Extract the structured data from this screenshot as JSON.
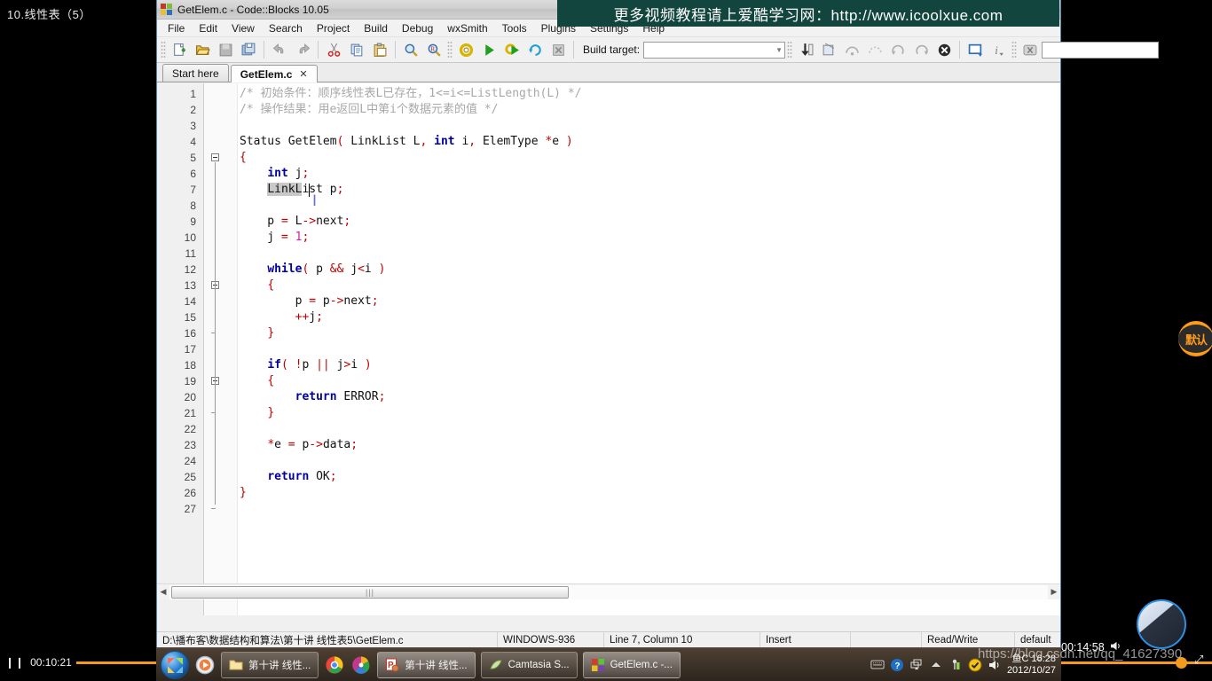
{
  "player": {
    "video_title": "10.线性表（5）",
    "elapsed_left": "00:10:21",
    "pause_glyph": "❙❙",
    "time_right": "00:14:58",
    "volume_icon": "volume-icon",
    "fullscreen_icon": "fullscreen-icon",
    "watermark": "https://blog.csdn.net/qq_41627390"
  },
  "promo_banner": {
    "text": "更多视频教程请上爱酷学习网：http://www.icoolxue.com"
  },
  "badge": {
    "label": "默认"
  },
  "window": {
    "title": "GetElem.c - Code::Blocks 10.05",
    "logo_icon": "codeblocks-logo-icon"
  },
  "menubar": {
    "items": [
      "File",
      "Edit",
      "View",
      "Search",
      "Project",
      "Build",
      "Debug",
      "wxSmith",
      "Tools",
      "Plugins",
      "Settings",
      "Help"
    ]
  },
  "toolbar": {
    "main_icons": [
      "new-file-icon",
      "open-file-icon",
      "save-icon",
      "save-all-icon",
      "undo-icon",
      "redo-icon",
      "cut-icon",
      "copy-icon",
      "paste-icon",
      "find-icon",
      "replace-icon"
    ],
    "compiler_icons": [
      "build-icon",
      "run-icon",
      "build-and-run-icon",
      "rebuild-icon",
      "abort-icon"
    ],
    "build_target_label": "Build target:",
    "build_target_value": "",
    "debug_icons": [
      "debug-continue-icon",
      "debug-run-to-cursor-icon",
      "debug-next-line-icon",
      "debug-step-into-icon",
      "debug-step-out-icon",
      "debug-next-instruction-icon",
      "debug-stop-icon",
      "debug-windows-icon",
      "debug-info-icon"
    ],
    "doc_icons": [
      "doc-help-icon"
    ],
    "search_value": ""
  },
  "tabs": [
    {
      "label": "Start here",
      "active": false,
      "closable": false
    },
    {
      "label": "GetElem.c",
      "active": true,
      "closable": true,
      "close_icon": "close-icon"
    }
  ],
  "editor": {
    "selection_text": "LinkL",
    "caret_line": 7,
    "lines": [
      {
        "n": 1,
        "tokens": [
          {
            "t": "/* 初始条件：顺序线性表L已存在，1<=i<=ListLength(L) */",
            "c": "cmt"
          }
        ]
      },
      {
        "n": 2,
        "tokens": [
          {
            "t": "/* 操作结果：用e返回L中第i个数据元素的值 */",
            "c": "cmt"
          }
        ]
      },
      {
        "n": 3,
        "tokens": []
      },
      {
        "n": 4,
        "tokens": [
          {
            "t": "Status GetElem",
            "c": ""
          },
          {
            "t": "(",
            "c": "pun"
          },
          {
            "t": " LinkList L",
            "c": ""
          },
          {
            "t": ",",
            "c": "pun"
          },
          {
            "t": " ",
            "c": ""
          },
          {
            "t": "int",
            "c": "kw"
          },
          {
            "t": " i",
            "c": ""
          },
          {
            "t": ",",
            "c": "pun"
          },
          {
            "t": " ElemType ",
            "c": ""
          },
          {
            "t": "*",
            "c": "pun"
          },
          {
            "t": "e ",
            "c": ""
          },
          {
            "t": ")",
            "c": "pun"
          }
        ]
      },
      {
        "n": 5,
        "tokens": [
          {
            "t": "{",
            "c": "pun"
          }
        ]
      },
      {
        "n": 6,
        "tokens": [
          {
            "t": "    ",
            "c": ""
          },
          {
            "t": "int",
            "c": "kw"
          },
          {
            "t": " j",
            "c": ""
          },
          {
            "t": ";",
            "c": "pun"
          }
        ]
      },
      {
        "n": 7,
        "tokens": [
          {
            "t": "    ",
            "c": ""
          },
          {
            "t": "LinkL",
            "c": "sel"
          },
          {
            "t": "ist p",
            "c": ""
          },
          {
            "t": ";",
            "c": "pun"
          }
        ]
      },
      {
        "n": 8,
        "tokens": []
      },
      {
        "n": 9,
        "tokens": [
          {
            "t": "    p ",
            "c": ""
          },
          {
            "t": "=",
            "c": "pun"
          },
          {
            "t": " L",
            "c": ""
          },
          {
            "t": "->",
            "c": "pun"
          },
          {
            "t": "next",
            "c": ""
          },
          {
            "t": ";",
            "c": "pun"
          }
        ]
      },
      {
        "n": 10,
        "tokens": [
          {
            "t": "    j ",
            "c": ""
          },
          {
            "t": "=",
            "c": "pun"
          },
          {
            "t": " ",
            "c": ""
          },
          {
            "t": "1",
            "c": "num"
          },
          {
            "t": ";",
            "c": "pun"
          }
        ]
      },
      {
        "n": 11,
        "tokens": []
      },
      {
        "n": 12,
        "tokens": [
          {
            "t": "    ",
            "c": ""
          },
          {
            "t": "while",
            "c": "kw"
          },
          {
            "t": "(",
            "c": "pun"
          },
          {
            "t": " p ",
            "c": ""
          },
          {
            "t": "&&",
            "c": "pun"
          },
          {
            "t": " j",
            "c": ""
          },
          {
            "t": "<",
            "c": "pun"
          },
          {
            "t": "i ",
            "c": ""
          },
          {
            "t": ")",
            "c": "pun"
          }
        ]
      },
      {
        "n": 13,
        "tokens": [
          {
            "t": "    ",
            "c": ""
          },
          {
            "t": "{",
            "c": "pun"
          }
        ]
      },
      {
        "n": 14,
        "tokens": [
          {
            "t": "        p ",
            "c": ""
          },
          {
            "t": "=",
            "c": "pun"
          },
          {
            "t": " p",
            "c": ""
          },
          {
            "t": "->",
            "c": "pun"
          },
          {
            "t": "next",
            "c": ""
          },
          {
            "t": ";",
            "c": "pun"
          }
        ]
      },
      {
        "n": 15,
        "tokens": [
          {
            "t": "        ",
            "c": ""
          },
          {
            "t": "++",
            "c": "pun"
          },
          {
            "t": "j",
            "c": ""
          },
          {
            "t": ";",
            "c": "pun"
          }
        ]
      },
      {
        "n": 16,
        "tokens": [
          {
            "t": "    ",
            "c": ""
          },
          {
            "t": "}",
            "c": "pun"
          }
        ]
      },
      {
        "n": 17,
        "tokens": []
      },
      {
        "n": 18,
        "tokens": [
          {
            "t": "    ",
            "c": ""
          },
          {
            "t": "if",
            "c": "kw"
          },
          {
            "t": "(",
            "c": "pun"
          },
          {
            "t": " ",
            "c": ""
          },
          {
            "t": "!",
            "c": "pun"
          },
          {
            "t": "p ",
            "c": ""
          },
          {
            "t": "||",
            "c": "pun"
          },
          {
            "t": " j",
            "c": ""
          },
          {
            "t": ">",
            "c": "pun"
          },
          {
            "t": "i ",
            "c": ""
          },
          {
            "t": ")",
            "c": "pun"
          }
        ]
      },
      {
        "n": 19,
        "tokens": [
          {
            "t": "    ",
            "c": ""
          },
          {
            "t": "{",
            "c": "pun"
          }
        ]
      },
      {
        "n": 20,
        "tokens": [
          {
            "t": "        ",
            "c": ""
          },
          {
            "t": "return",
            "c": "kw"
          },
          {
            "t": " ERROR",
            "c": ""
          },
          {
            "t": ";",
            "c": "pun"
          }
        ]
      },
      {
        "n": 21,
        "tokens": [
          {
            "t": "    ",
            "c": ""
          },
          {
            "t": "}",
            "c": "pun"
          }
        ]
      },
      {
        "n": 22,
        "tokens": []
      },
      {
        "n": 23,
        "tokens": [
          {
            "t": "    ",
            "c": ""
          },
          {
            "t": "*",
            "c": "pun"
          },
          {
            "t": "e ",
            "c": ""
          },
          {
            "t": "=",
            "c": "pun"
          },
          {
            "t": " p",
            "c": ""
          },
          {
            "t": "->",
            "c": "pun"
          },
          {
            "t": "data",
            "c": ""
          },
          {
            "t": ";",
            "c": "pun"
          }
        ]
      },
      {
        "n": 24,
        "tokens": []
      },
      {
        "n": 25,
        "tokens": [
          {
            "t": "    ",
            "c": ""
          },
          {
            "t": "return",
            "c": "kw"
          },
          {
            "t": " OK",
            "c": ""
          },
          {
            "t": ";",
            "c": "pun"
          }
        ]
      },
      {
        "n": 26,
        "tokens": [
          {
            "t": "}",
            "c": "pun"
          }
        ]
      },
      {
        "n": 27,
        "tokens": []
      }
    ]
  },
  "statusbar": {
    "file_path": "D:\\播布客\\数据结构和算法\\第十讲 线性表5\\GetElem.c",
    "encoding": "WINDOWS-936",
    "caret": "Line 7, Column 10",
    "insert_mode": "Insert",
    "blank": "",
    "access": "Read/Write",
    "profile": "default"
  },
  "taskbar": {
    "start_icon": "windows-start-orb-icon",
    "quicklaunch": [
      "media-player-icon"
    ],
    "buttons": [
      {
        "label": "第十讲 线性...",
        "icon": "folder-icon",
        "active": false
      },
      {
        "label": "",
        "icon": "chrome-icon",
        "active": false
      },
      {
        "label": "",
        "icon": "pinwheel-icon",
        "active": false
      },
      {
        "label": "第十讲 线性...",
        "icon": "powerpoint-icon",
        "active": true
      },
      {
        "label": "Camtasia S...",
        "icon": "camtasia-icon",
        "active": false
      },
      {
        "label": "GetElem.c -...",
        "icon": "codeblocks-logo-icon",
        "active": true
      }
    ],
    "tray_icons": [
      "keyboard-icon",
      "help-icon",
      "show-desktop-icon",
      "show-hidden-icons-icon",
      "network-icon",
      "antivirus-icon",
      "volume-icon"
    ],
    "clock_line1": "鱼C 16:28",
    "clock_line2": "2012/10/27"
  }
}
